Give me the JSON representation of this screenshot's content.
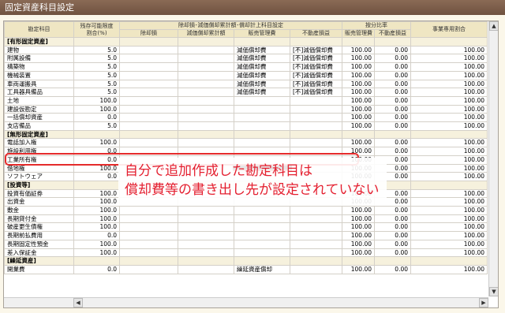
{
  "window": {
    "title": "固定資産科目設定"
  },
  "headers": {
    "account": "勘定科目",
    "depreciable_limit": "残存可能限度\n割合(%)",
    "group": "除却損･減価償却累計額･償却計上科目設定",
    "disposal_loss": "除却損",
    "accumulated": "減価償却累計額",
    "sga": "販売管理費",
    "non_operating": "不動産損益",
    "ratio_group": "按分比率",
    "ratio_sga": "販売管理費",
    "ratio_non_op": "不動産損益",
    "business_ratio": "事業専用割合"
  },
  "rows": [
    {
      "type": "section",
      "label": "[有形固定資産]"
    },
    {
      "label": "建物",
      "limit": "5.0",
      "disposal": "",
      "accum": "",
      "sga": "減価償却費",
      "nonop": "[不]減価償却費",
      "r1": "100.00",
      "r2": "0.00",
      "biz": "100.00"
    },
    {
      "label": "附属設備",
      "limit": "5.0",
      "disposal": "",
      "accum": "",
      "sga": "減価償却費",
      "nonop": "[不]減価償却費",
      "r1": "100.00",
      "r2": "0.00",
      "biz": "100.00"
    },
    {
      "label": "構築物",
      "limit": "5.0",
      "disposal": "",
      "accum": "",
      "sga": "減価償却費",
      "nonop": "[不]減価償却費",
      "r1": "100.00",
      "r2": "0.00",
      "biz": "100.00"
    },
    {
      "label": "機械装置",
      "limit": "5.0",
      "disposal": "",
      "accum": "",
      "sga": "減価償却費",
      "nonop": "[不]減価償却費",
      "r1": "100.00",
      "r2": "0.00",
      "biz": "100.00"
    },
    {
      "label": "車両運搬具",
      "limit": "5.0",
      "disposal": "",
      "accum": "",
      "sga": "減価償却費",
      "nonop": "[不]減価償却費",
      "r1": "100.00",
      "r2": "0.00",
      "biz": "100.00"
    },
    {
      "label": "工具器具備品",
      "limit": "5.0",
      "disposal": "",
      "accum": "",
      "sga": "減価償却費",
      "nonop": "[不]減価償却費",
      "r1": "100.00",
      "r2": "0.00",
      "biz": "100.00"
    },
    {
      "label": "土地",
      "limit": "100.0",
      "disposal": "",
      "accum": "",
      "sga": "",
      "nonop": "",
      "r1": "100.00",
      "r2": "0.00",
      "biz": "100.00"
    },
    {
      "label": "建設仮勘定",
      "limit": "100.0",
      "disposal": "",
      "accum": "",
      "sga": "",
      "nonop": "",
      "r1": "100.00",
      "r2": "0.00",
      "biz": "100.00"
    },
    {
      "label": "一括償却資産",
      "limit": "0.0",
      "disposal": "",
      "accum": "",
      "sga": "",
      "nonop": "",
      "r1": "100.00",
      "r2": "0.00",
      "biz": "100.00"
    },
    {
      "label": "支店備品",
      "limit": "5.0",
      "disposal": "",
      "accum": "",
      "sga": "",
      "nonop": "",
      "r1": "100.00",
      "r2": "0.00",
      "biz": "100.00"
    },
    {
      "type": "section",
      "label": "[無形固定資産]"
    },
    {
      "label": "電話加入権",
      "limit": "100.0",
      "disposal": "",
      "accum": "",
      "sga": "",
      "nonop": "",
      "r1": "100.00",
      "r2": "0.00",
      "biz": "100.00"
    },
    {
      "label": "施設利用権",
      "limit": "0.0",
      "disposal": "",
      "accum": "",
      "sga": "",
      "nonop": "",
      "r1": "100.00",
      "r2": "0.00",
      "biz": "100.00"
    },
    {
      "label": "工業所有権",
      "limit": "0.0",
      "disposal": "",
      "accum": "",
      "sga": "",
      "nonop": "",
      "r1": "100.00",
      "r2": "0.00",
      "biz": "100.00"
    },
    {
      "label": "借地権",
      "limit": "100.0",
      "disposal": "",
      "accum": "",
      "sga": "",
      "nonop": "",
      "r1": "100.00",
      "r2": "0.00",
      "biz": "100.00"
    },
    {
      "label": "ソフトウェア",
      "limit": "0.0",
      "disposal": "",
      "accum": "",
      "sga": "",
      "nonop": "",
      "r1": "100.00",
      "r2": "0.00",
      "biz": "100.00"
    },
    {
      "type": "section",
      "label": "[投資等]"
    },
    {
      "label": "投資有価証券",
      "limit": "100.0",
      "disposal": "",
      "accum": "",
      "sga": "",
      "nonop": "",
      "r1": "100.00",
      "r2": "0.00",
      "biz": "100.00"
    },
    {
      "label": "出資金",
      "limit": "100.0",
      "disposal": "",
      "accum": "",
      "sga": "",
      "nonop": "",
      "r1": "100.00",
      "r2": "0.00",
      "biz": "100.00"
    },
    {
      "label": "敷金",
      "limit": "100.0",
      "disposal": "",
      "accum": "",
      "sga": "",
      "nonop": "",
      "r1": "100.00",
      "r2": "0.00",
      "biz": "100.00"
    },
    {
      "label": "長期貸付金",
      "limit": "100.0",
      "disposal": "",
      "accum": "",
      "sga": "",
      "nonop": "",
      "r1": "100.00",
      "r2": "0.00",
      "biz": "100.00"
    },
    {
      "label": "破産更生債権",
      "limit": "100.0",
      "disposal": "",
      "accum": "",
      "sga": "",
      "nonop": "",
      "r1": "100.00",
      "r2": "0.00",
      "biz": "100.00"
    },
    {
      "label": "長期前払費用",
      "limit": "0.0",
      "disposal": "",
      "accum": "",
      "sga": "",
      "nonop": "",
      "r1": "100.00",
      "r2": "0.00",
      "biz": "100.00"
    },
    {
      "label": "長期固定性預金",
      "limit": "100.0",
      "disposal": "",
      "accum": "",
      "sga": "",
      "nonop": "",
      "r1": "100.00",
      "r2": "0.00",
      "biz": "100.00"
    },
    {
      "label": "差入保証金",
      "limit": "100.0",
      "disposal": "",
      "accum": "",
      "sga": "",
      "nonop": "",
      "r1": "100.00",
      "r2": "0.00",
      "biz": "100.00"
    },
    {
      "type": "section",
      "label": "[繰延資産]"
    },
    {
      "label": "開業費",
      "limit": "0.0",
      "disposal": "",
      "accum": "",
      "sga": "繰延資産償却",
      "nonop": "",
      "r1": "100.00",
      "r2": "0.00",
      "biz": "100.00"
    }
  ],
  "callout": {
    "line1": "自分で追加作成した勘定科目は",
    "line2": "償却費等の書き出し先が設定されていない"
  },
  "colors": {
    "title_bg": "#7a5c48",
    "header_bg": "#efe6c3",
    "callout_text": "#e41f2f",
    "highlight": "#e52b2b"
  },
  "icons": {
    "scroll_up": "▲",
    "scroll_down": "▼",
    "scroll_left": "◀",
    "scroll_right": "▶"
  }
}
